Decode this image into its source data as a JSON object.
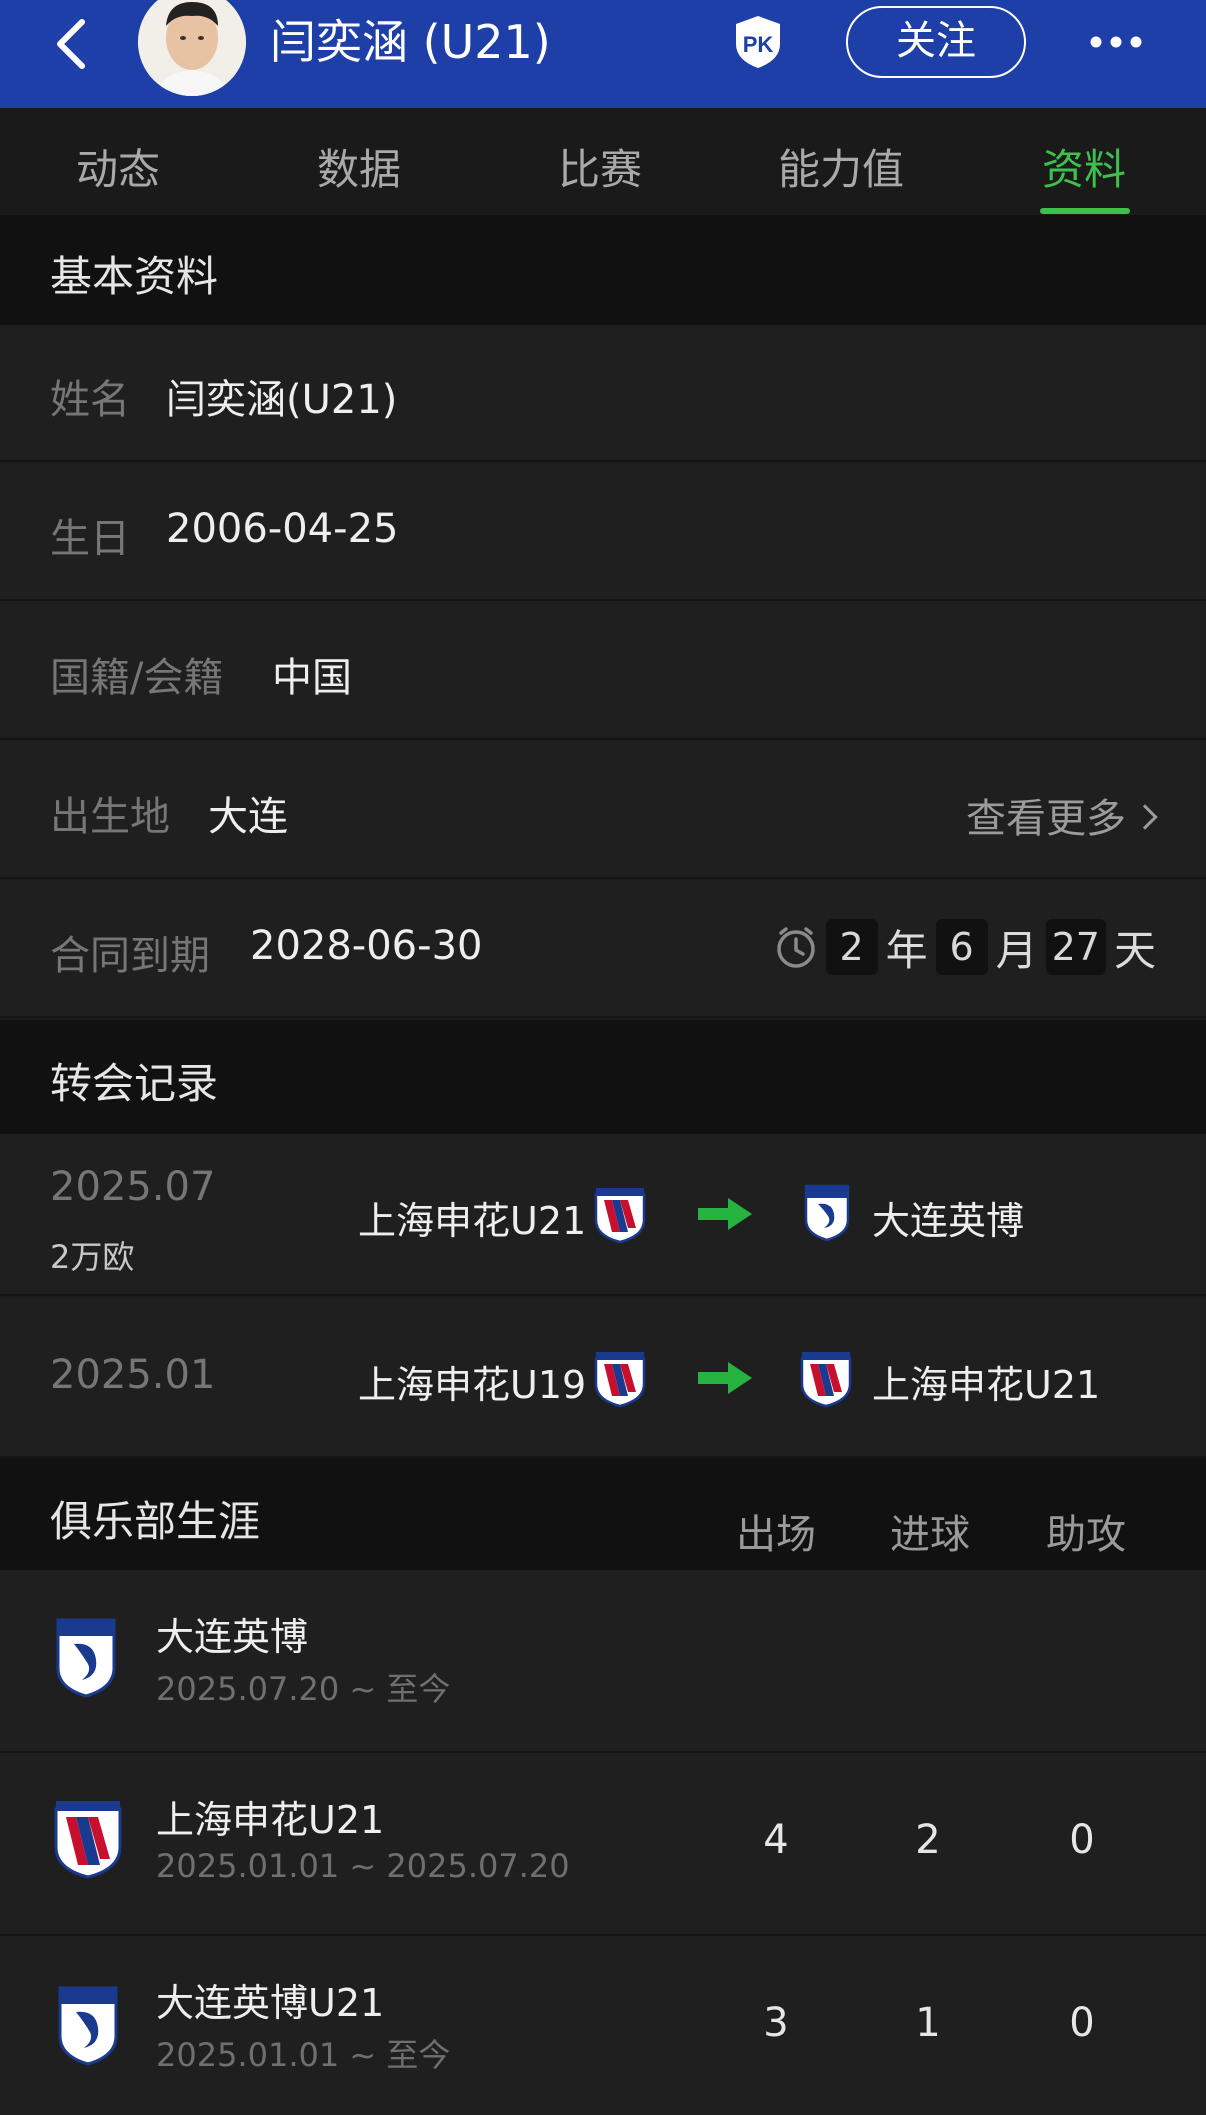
{
  "header": {
    "title": "闫奕涵 (U21)",
    "follow_label": "关注",
    "pk_label": "PK",
    "bg_color": "#1e3fa8"
  },
  "tabs": [
    {
      "label": "动态",
      "active": false
    },
    {
      "label": "数据",
      "active": false
    },
    {
      "label": "比赛",
      "active": false
    },
    {
      "label": "能力值",
      "active": false
    },
    {
      "label": "资料",
      "active": true
    }
  ],
  "accent_color": "#3fbf4e",
  "basic_info": {
    "section_title": "基本资料",
    "name": {
      "label": "姓名",
      "value": "闫奕涵(U21)"
    },
    "birthday": {
      "label": "生日",
      "value": "2006-04-25"
    },
    "nationality": {
      "label": "国籍/会籍",
      "value": "中国"
    },
    "birthplace": {
      "label": "出生地",
      "value": "大连",
      "more_label": "查看更多"
    },
    "contract": {
      "label": "合同到期",
      "value": "2028-06-30",
      "countdown": {
        "years": "2",
        "years_unit": "年",
        "months": "6",
        "months_unit": "月",
        "days": "27",
        "days_unit": "天"
      }
    }
  },
  "transfers": {
    "section_title": "转会记录",
    "rows": [
      {
        "date": "2025.07",
        "fee": "2万欧",
        "from": "上海申花U21",
        "from_logo": "shenhua-logo",
        "to": "大连英博",
        "to_logo": "dalian-logo"
      },
      {
        "date": "2025.01",
        "fee": "",
        "from": "上海申花U19",
        "from_logo": "shenhua-logo",
        "to": "上海申花U21",
        "to_logo": "shenhua-logo"
      }
    ]
  },
  "career": {
    "section_title": "俱乐部生涯",
    "columns": [
      "出场",
      "进球",
      "助攻"
    ],
    "rows": [
      {
        "club": "大连英博",
        "period": "2025.07.20 ~ 至今",
        "apps": "",
        "goals": "",
        "assists": "",
        "logo": "dalian-logo"
      },
      {
        "club": "上海申花U21",
        "period": "2025.01.01 ~ 2025.07.20",
        "apps": "4",
        "goals": "2",
        "assists": "0",
        "logo": "shenhua-logo"
      },
      {
        "club": "大连英博U21",
        "period": "2025.01.01 ~ 至今",
        "apps": "3",
        "goals": "1",
        "assists": "0",
        "logo": "dalian-logo"
      }
    ]
  }
}
